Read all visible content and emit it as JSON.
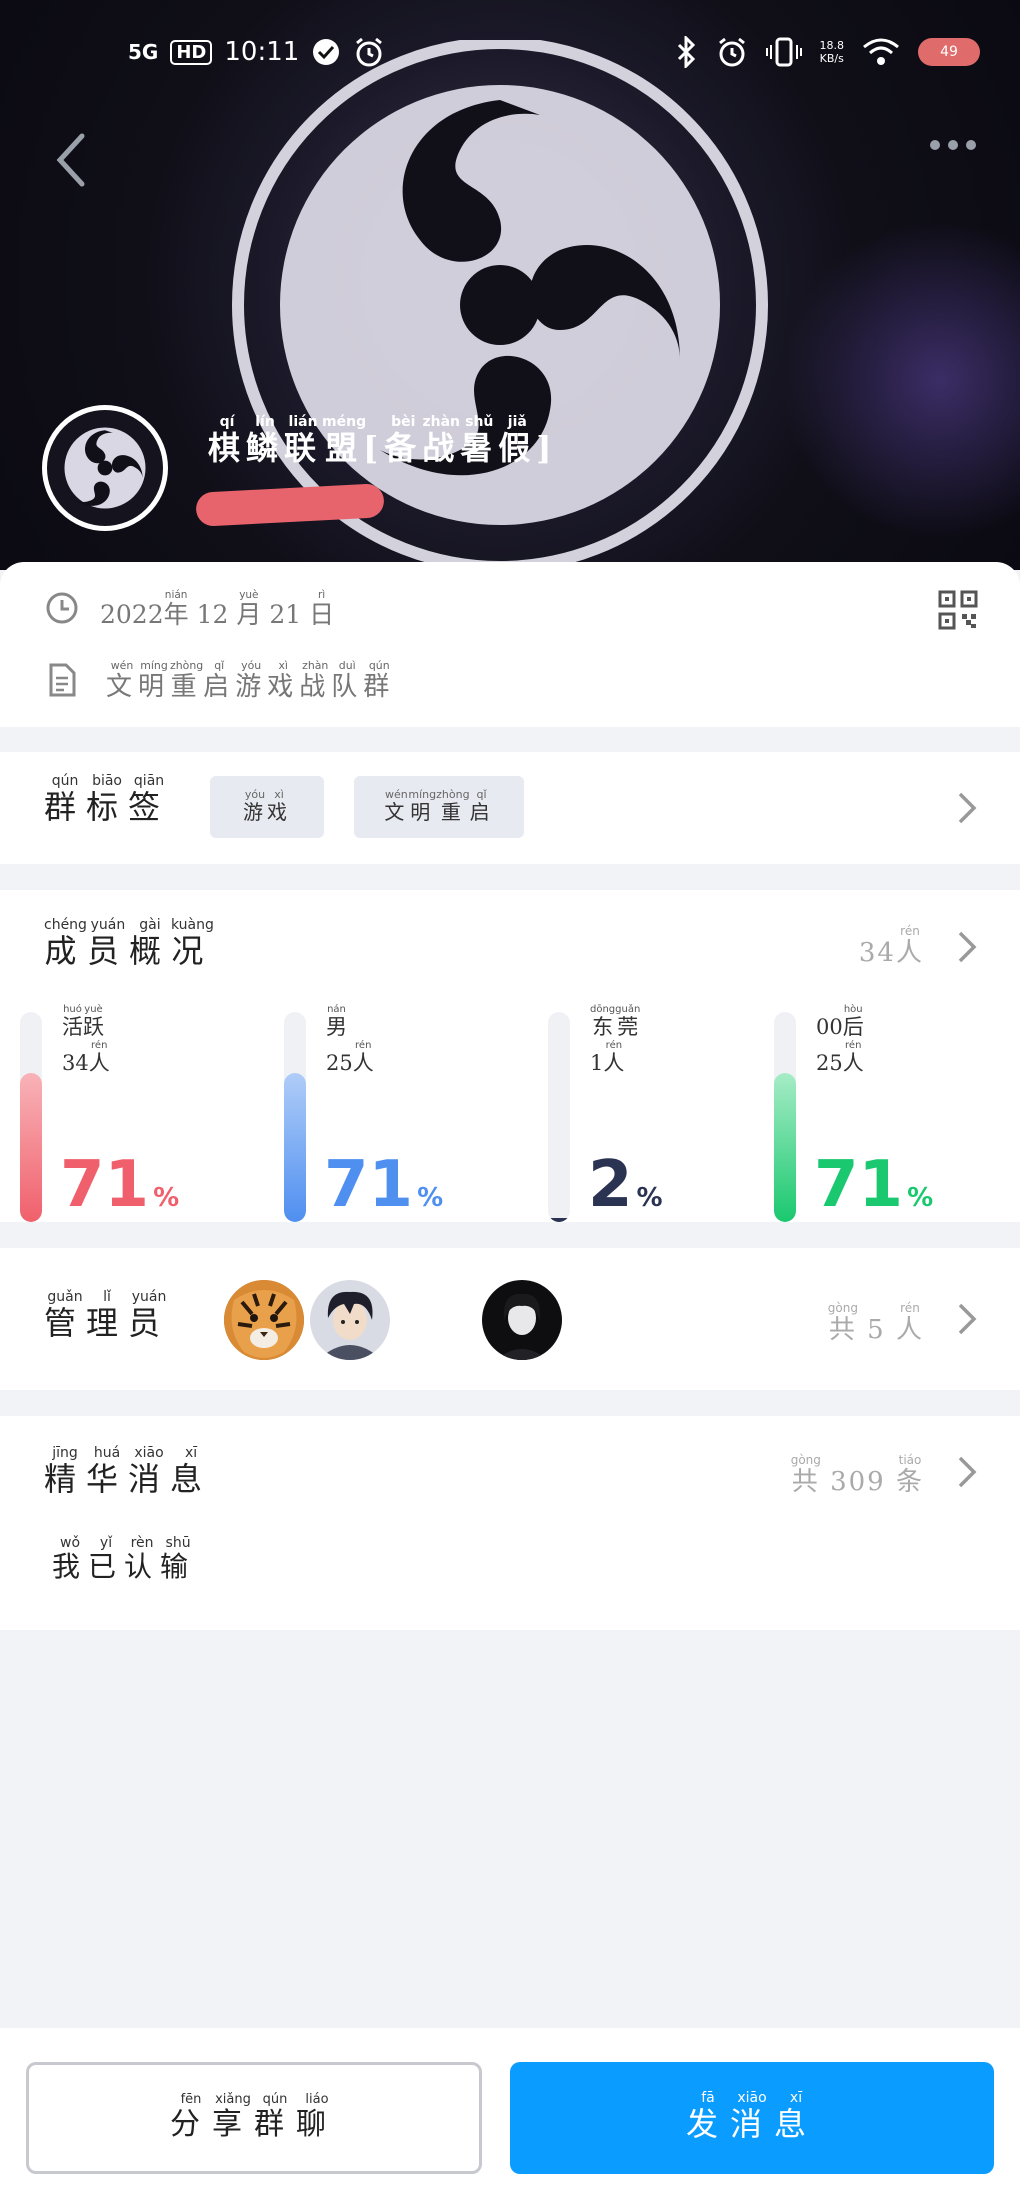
{
  "status_bar": {
    "network": "5G",
    "hd": "HD",
    "time": "10:11",
    "speed_value": "18.8",
    "speed_unit": "KB/s",
    "battery": "49"
  },
  "group": {
    "name": [
      {
        "c": "棋",
        "p": "qí"
      },
      {
        "c": "鳞",
        "p": "lín"
      },
      {
        "c": "联",
        "p": "lián"
      },
      {
        "c": "盟",
        "p": "méng"
      },
      {
        "c": "[",
        "p": ""
      },
      {
        "c": "备",
        "p": "bèi"
      },
      {
        "c": "战",
        "p": "zhàn"
      },
      {
        "c": "暑",
        "p": "shǔ"
      },
      {
        "c": "假",
        "p": "jiǎ"
      },
      {
        "c": "]",
        "p": ""
      }
    ]
  },
  "info": {
    "date": [
      {
        "c": "2022",
        "p": ""
      },
      {
        "c": "年",
        "p": "nián"
      },
      {
        "c": " 12 ",
        "p": ""
      },
      {
        "c": "月",
        "p": "yuè"
      },
      {
        "c": " 21 ",
        "p": ""
      },
      {
        "c": "日",
        "p": "rì"
      }
    ],
    "description": [
      {
        "c": "文",
        "p": "wén"
      },
      {
        "c": "明",
        "p": "míng"
      },
      {
        "c": "重",
        "p": "zhòng"
      },
      {
        "c": "启",
        "p": "qǐ"
      },
      {
        "c": "游",
        "p": "yóu"
      },
      {
        "c": "戏",
        "p": "xì"
      },
      {
        "c": "战",
        "p": "zhàn"
      },
      {
        "c": "队",
        "p": "duì"
      },
      {
        "c": "群",
        "p": "qún"
      }
    ]
  },
  "tags_section": {
    "title": [
      {
        "c": "群",
        "p": "qún"
      },
      {
        "c": "标",
        "p": "biāo"
      },
      {
        "c": "签",
        "p": "qiān"
      }
    ],
    "tags": [
      [
        {
          "c": "游",
          "p": "yóu"
        },
        {
          "c": "戏",
          "p": "xì"
        }
      ],
      [
        {
          "c": "文",
          "p": "wén"
        },
        {
          "c": "明",
          "p": "míng"
        },
        {
          "c": "重",
          "p": "zhòng"
        },
        {
          "c": "启",
          "p": "qǐ"
        }
      ]
    ]
  },
  "members_section": {
    "title": [
      {
        "c": "成",
        "p": "chéng"
      },
      {
        "c": "员",
        "p": "yuán"
      },
      {
        "c": "概",
        "p": "gài"
      },
      {
        "c": "况",
        "p": "kuàng"
      }
    ],
    "total": [
      {
        "c": "34",
        "p": ""
      },
      {
        "c": "人",
        "p": "rén"
      }
    ],
    "stats": [
      {
        "label": [
          {
            "c": "活",
            "p": "huó"
          },
          {
            "c": "跃",
            "p": "yuè"
          }
        ],
        "count": [
          {
            "c": "34",
            "p": ""
          },
          {
            "c": "人",
            "p": "rén"
          }
        ],
        "percent": 71,
        "color": "#f0606c",
        "color_light": "#f8b3b8"
      },
      {
        "label": [
          {
            "c": "男",
            "p": "nán"
          }
        ],
        "count": [
          {
            "c": "25",
            "p": ""
          },
          {
            "c": "人",
            "p": "rén"
          }
        ],
        "percent": 71,
        "color": "#4f8ff0",
        "color_light": "#b0cdf8"
      },
      {
        "label": [
          {
            "c": "东",
            "p": "dōng"
          },
          {
            "c": "莞",
            "p": "guǎn"
          }
        ],
        "count": [
          {
            "c": "1",
            "p": ""
          },
          {
            "c": "人",
            "p": "rén"
          }
        ],
        "percent": 2,
        "color": "#2b3352",
        "color_light": "#2b3352"
      },
      {
        "label": [
          {
            "c": "00",
            "p": ""
          },
          {
            "c": "后",
            "p": "hòu"
          }
        ],
        "count": [
          {
            "c": "25",
            "p": ""
          },
          {
            "c": "人",
            "p": "rén"
          }
        ],
        "percent": 71,
        "color": "#1ac86f",
        "color_light": "#a6ecc6"
      }
    ]
  },
  "admins_section": {
    "title": [
      {
        "c": "管",
        "p": "guǎn"
      },
      {
        "c": "理",
        "p": "lǐ"
      },
      {
        "c": "员",
        "p": "yuán"
      }
    ],
    "total": [
      {
        "c": "共",
        "p": "gòng"
      },
      {
        "c": " 5 ",
        "p": ""
      },
      {
        "c": "人",
        "p": "rén"
      }
    ]
  },
  "essence_section": {
    "title": [
      {
        "c": "精",
        "p": "jīng"
      },
      {
        "c": "华",
        "p": "huá"
      },
      {
        "c": "消",
        "p": "xiāo"
      },
      {
        "c": "息",
        "p": "xī"
      }
    ],
    "total": [
      {
        "c": "共",
        "p": "gòng"
      },
      {
        "c": " 309 ",
        "p": ""
      },
      {
        "c": "条",
        "p": "tiáo"
      }
    ],
    "preview": [
      {
        "c": "我",
        "p": "wǒ"
      },
      {
        "c": "已",
        "p": "yǐ"
      },
      {
        "c": "认",
        "p": "rèn"
      },
      {
        "c": "输",
        "p": "shū"
      }
    ]
  },
  "actions": {
    "share": [
      {
        "c": "分",
        "p": "fēn"
      },
      {
        "c": "享",
        "p": "xiǎng"
      },
      {
        "c": "群",
        "p": "qún"
      },
      {
        "c": "聊",
        "p": "liáo"
      }
    ],
    "send": [
      {
        "c": "发",
        "p": "fā"
      },
      {
        "c": "消",
        "p": "xiāo"
      },
      {
        "c": "息",
        "p": "xī"
      }
    ]
  },
  "icons": [
    "back-icon",
    "more-icon",
    "clock-icon",
    "document-icon",
    "qr-code-icon",
    "chevron-right-icon",
    "bluetooth-icon",
    "alarm-icon",
    "vibrate-icon",
    "wifi-icon",
    "check-circle-icon"
  ]
}
